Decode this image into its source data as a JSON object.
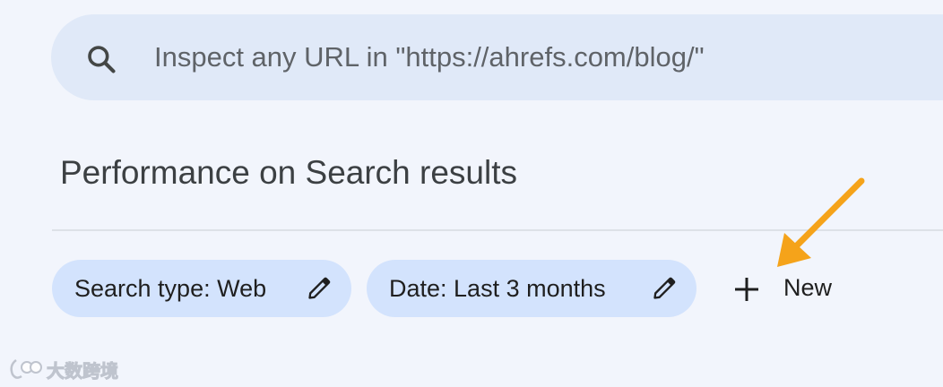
{
  "search": {
    "placeholder": "Inspect any URL in \"https://ahrefs.com/blog/\"",
    "icon": "search-icon"
  },
  "header": {
    "title": "Performance on Search results"
  },
  "filters": {
    "chips": [
      {
        "label": "Search type: Web",
        "icon": "pencil-icon"
      },
      {
        "label": "Date: Last 3 months",
        "icon": "pencil-icon"
      }
    ],
    "new_button": {
      "label": "New",
      "icon": "plus-icon"
    }
  },
  "annotation": {
    "arrow_color": "#f5a31a",
    "icon": "arrow-icon"
  },
  "watermark": {
    "text": "大数跨境"
  },
  "colors": {
    "background": "#f2f5fc",
    "search_bar": "#e0e9f8",
    "chip": "#d3e3fd",
    "text": "#1f1f1f"
  }
}
